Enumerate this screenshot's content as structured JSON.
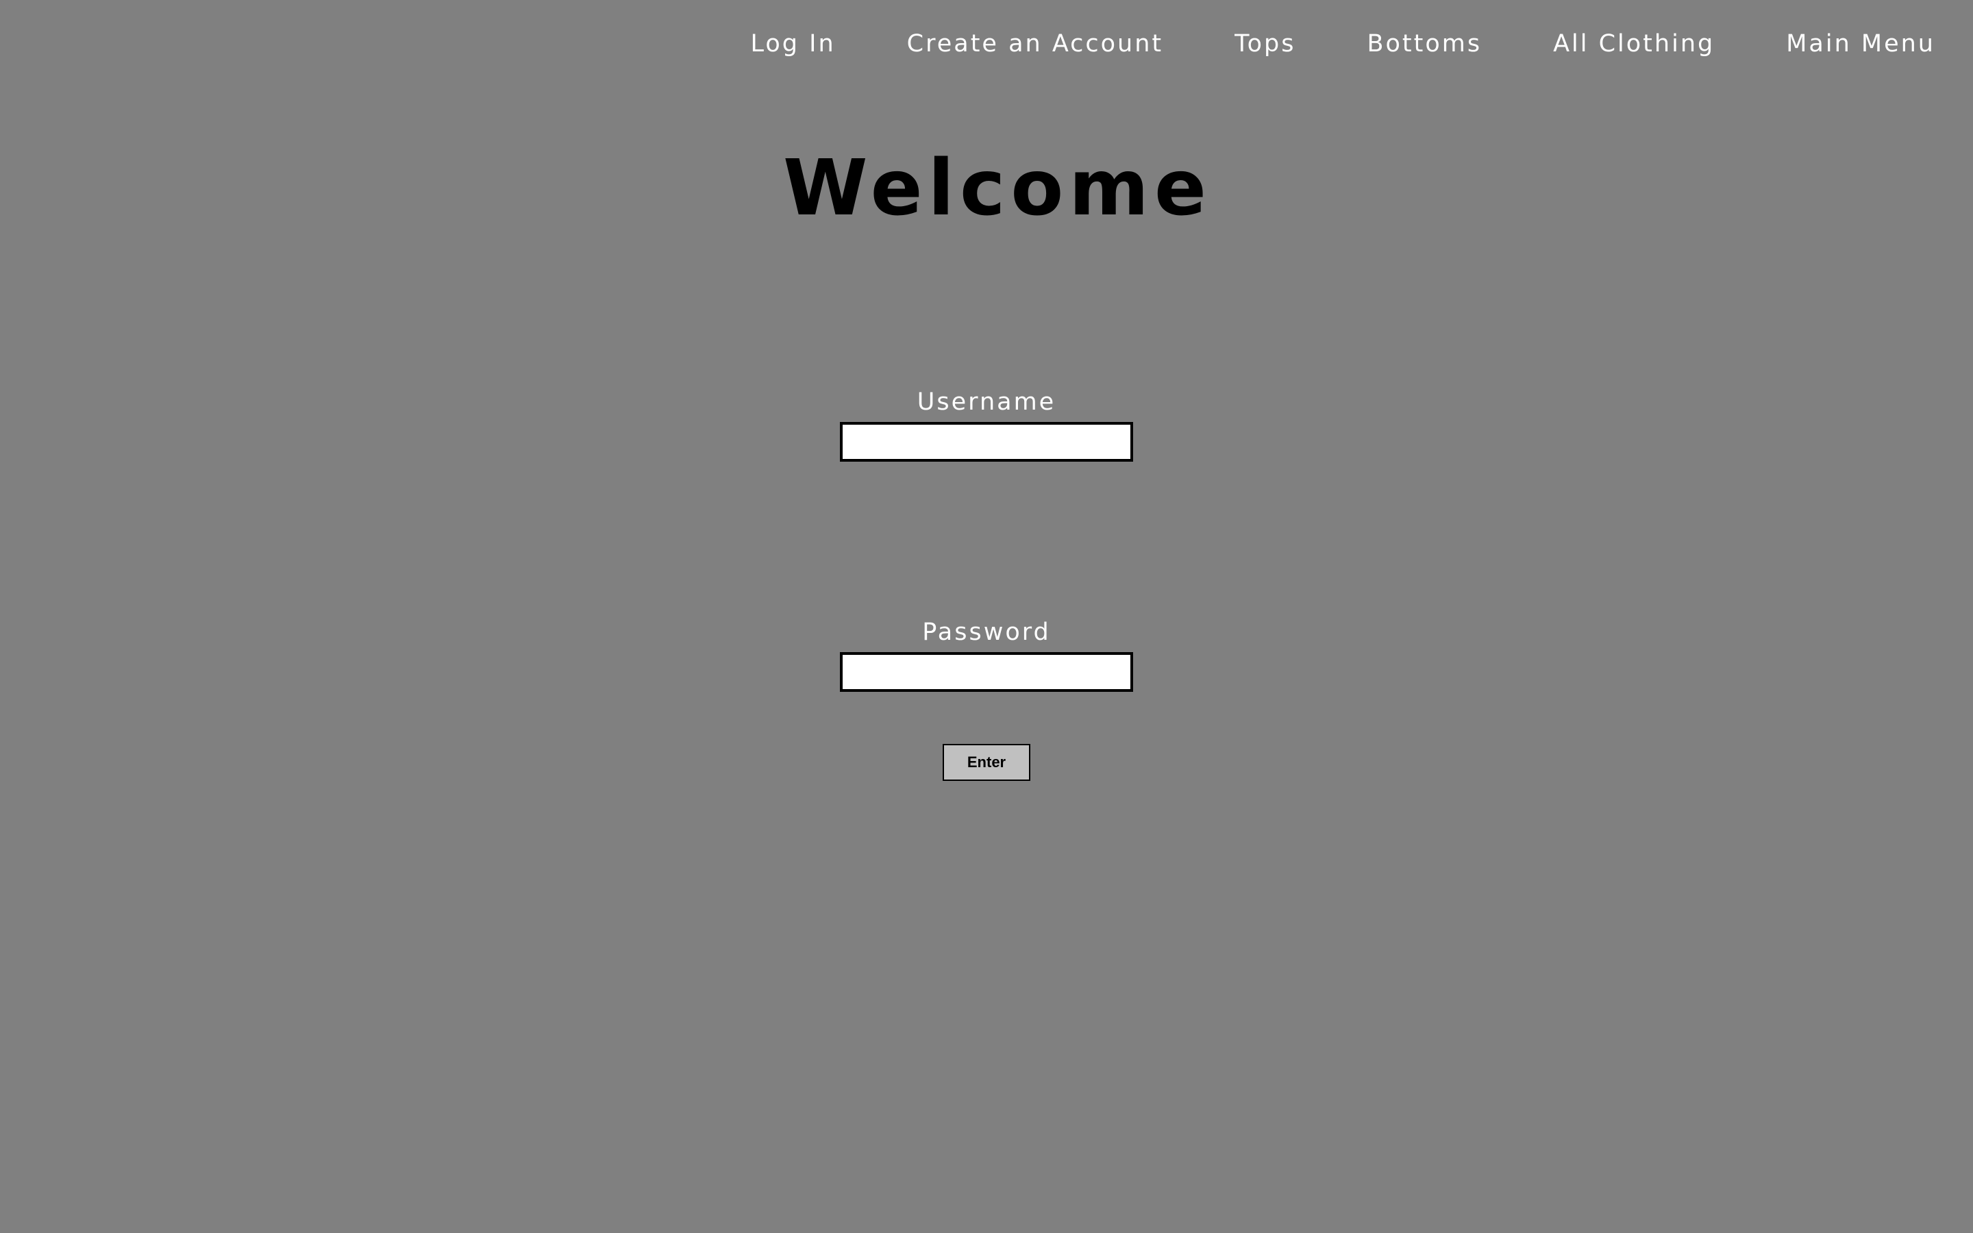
{
  "nav": {
    "items": [
      {
        "label": "Log In"
      },
      {
        "label": "Create an Account"
      },
      {
        "label": "Tops"
      },
      {
        "label": "Bottoms"
      },
      {
        "label": "All Clothing"
      },
      {
        "label": "Main Menu"
      }
    ]
  },
  "main": {
    "title": "Welcome",
    "username": {
      "label": "Username",
      "value": ""
    },
    "password": {
      "label": "Password",
      "value": ""
    },
    "enter_label": "Enter"
  },
  "colors": {
    "background": "#808080",
    "nav_text": "#ffffff",
    "title_text": "#000000",
    "input_background": "#ffffff",
    "button_background": "#c0c0c0"
  }
}
